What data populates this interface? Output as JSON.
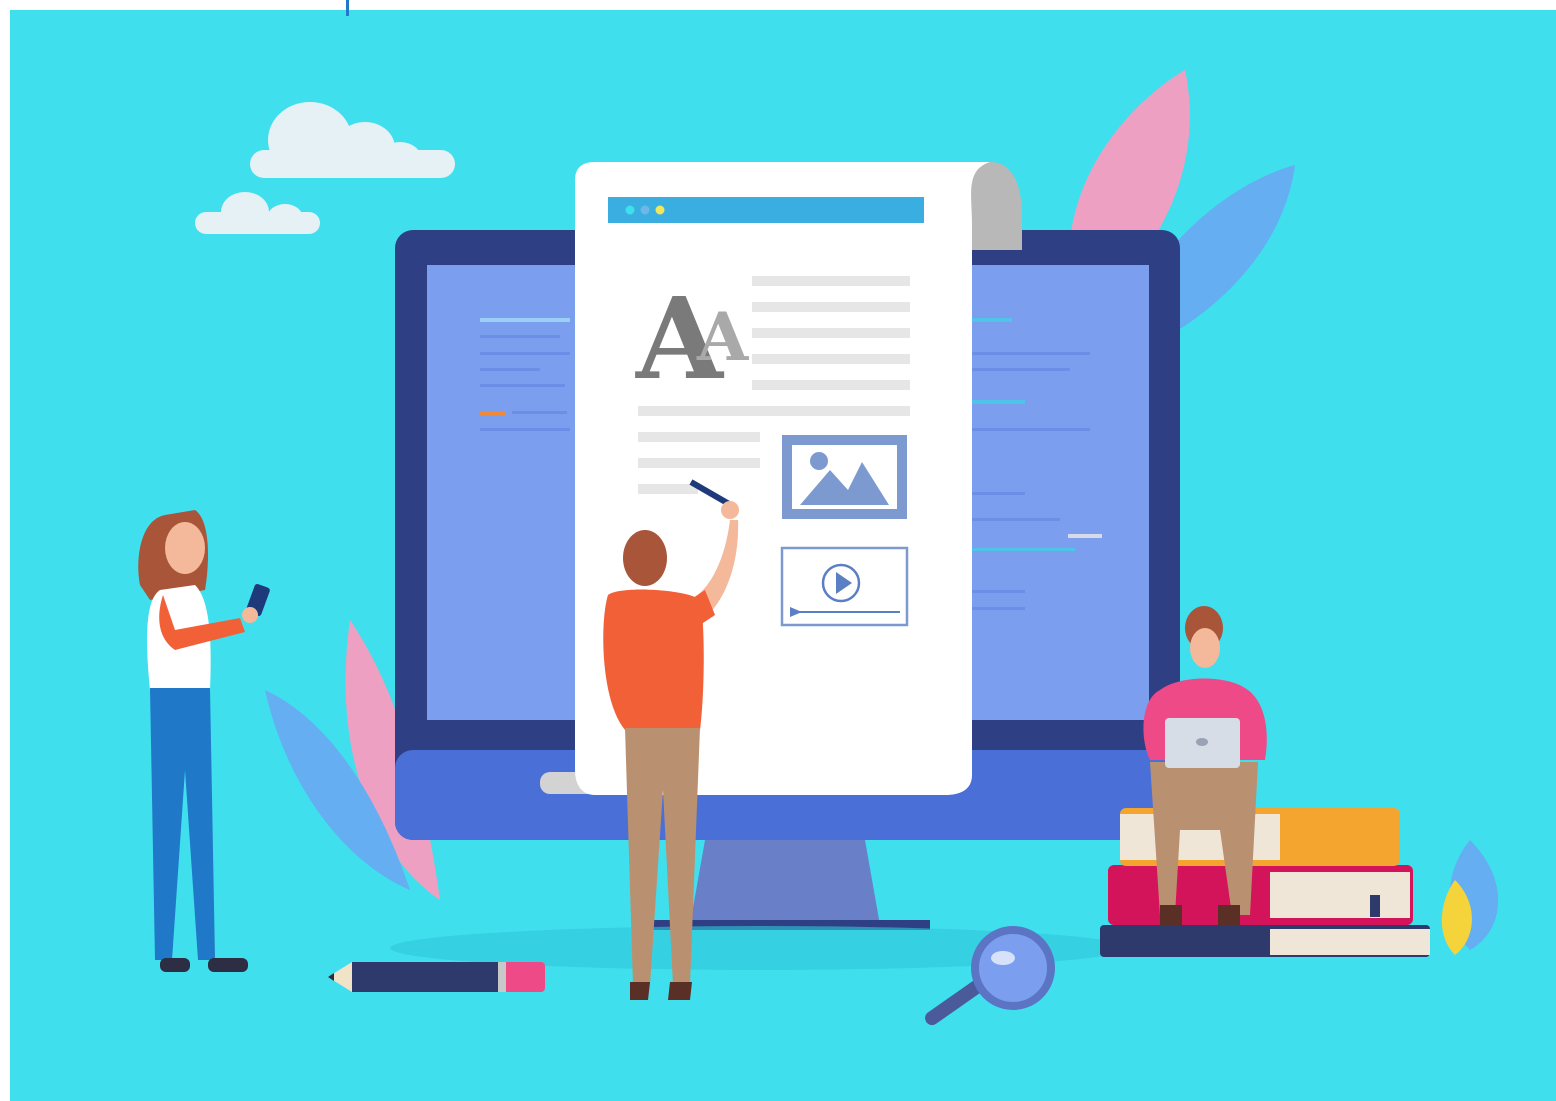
{
  "document": {
    "typography_glyph_large": "A",
    "typography_glyph_small": "A"
  },
  "colors": {
    "background": "#40dfee",
    "monitor_bezel": "#2e3f83",
    "monitor_screen": "#7b9fee",
    "monitor_chin": "#4a6fd6",
    "paper": "#ffffff",
    "paper_header_bar": "#3aaee0",
    "placeholder_lines": "#e6e6e6",
    "media_frame": "#7d9ad0",
    "leaf_pink": "#eea0c2",
    "leaf_blue": "#64aef1",
    "cloud": "#e6f1f6",
    "shirt_orange": "#f26038",
    "shirt_pink": "#ee4a87"
  },
  "icons": [
    "window-dots-icon",
    "typography-icon",
    "image-placeholder-icon",
    "play-icon",
    "magnifier-icon",
    "pencil-icon",
    "smartphone-icon",
    "laptop-icon"
  ]
}
